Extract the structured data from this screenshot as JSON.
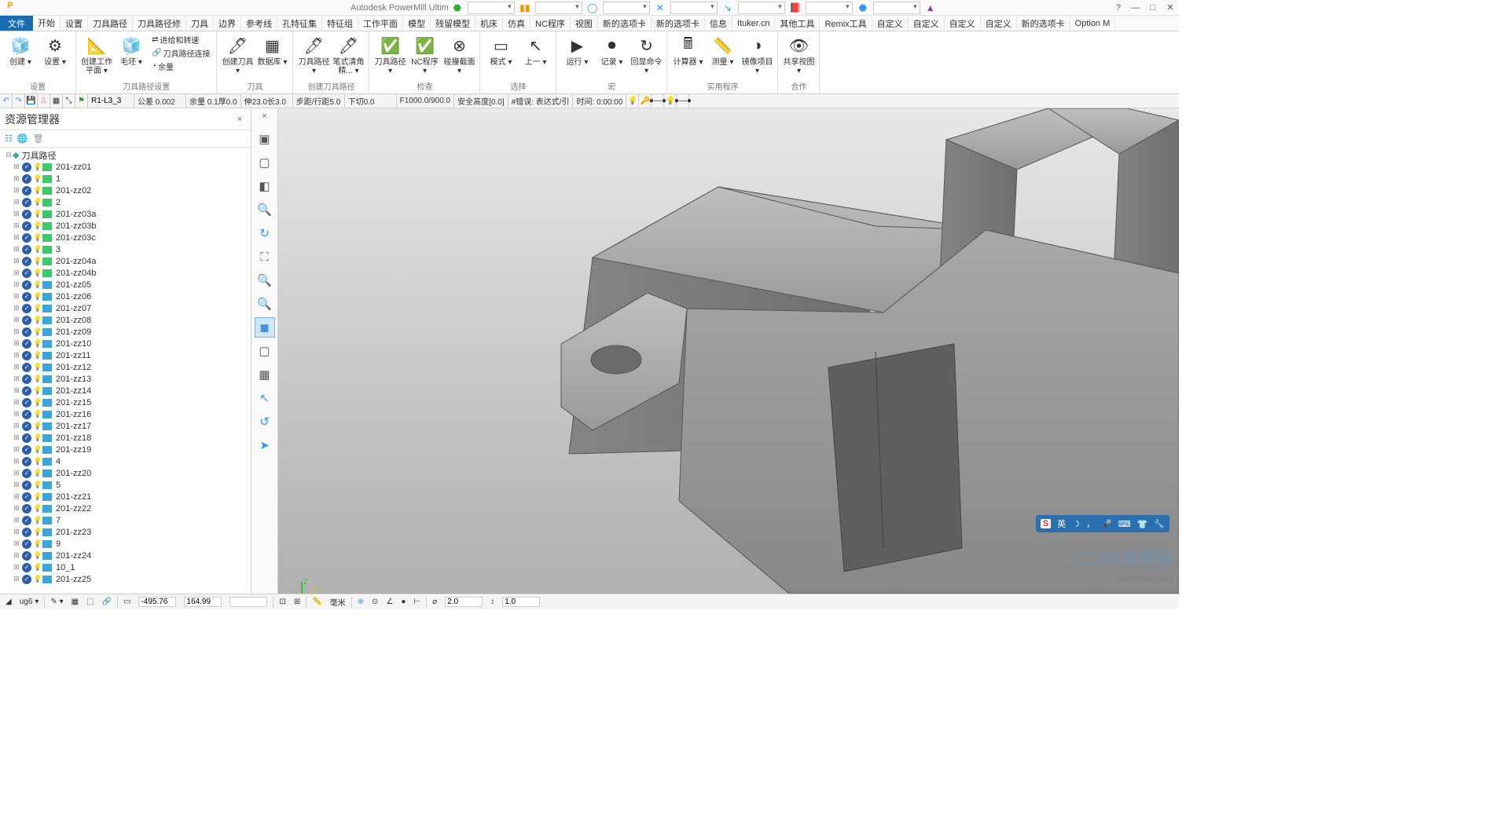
{
  "app_title": "Autodesk PowerMill Ultim",
  "window": {
    "help": "?",
    "min": "—",
    "max": "□",
    "close": "✕"
  },
  "menu": {
    "file": "文件",
    "tabs": [
      "开始",
      "设置",
      "刀具路径",
      "刀具路径修",
      "刀具",
      "边界",
      "参考线",
      "孔特征集",
      "特征组",
      "工作平面",
      "模型",
      "残留模型",
      "机床",
      "仿真",
      "NC程序",
      "视图",
      "新的选项卡",
      "新的选项卡",
      "信息",
      "Ituker.cn",
      "其他工具",
      "Remix工具",
      "自定义",
      "自定义",
      "自定义",
      "自定义",
      "新的选项卡",
      "Option M"
    ],
    "active": 0
  },
  "ribbon": {
    "groups": [
      {
        "name": "设置",
        "btns": [
          {
            "icon": "🧊",
            "lbl": "创建"
          },
          {
            "icon": "⚙",
            "lbl": "设置"
          }
        ]
      },
      {
        "name": "刀具路径设置",
        "btns": [
          {
            "icon": "📐",
            "lbl": "创建工作平面"
          },
          {
            "icon": "🧊",
            "lbl": "毛坯"
          }
        ],
        "small": [
          {
            "i": "⇄",
            "t": "进给和转速"
          },
          {
            "i": "🔗",
            "t": "刀具路径连接"
          },
          {
            "i": "◔",
            "t": "余量"
          }
        ]
      },
      {
        "name": "刀具",
        "btns": [
          {
            "icon": "🖊",
            "lbl": "创建刀具"
          },
          {
            "icon": "▦",
            "lbl": "数据库"
          }
        ]
      },
      {
        "name": "创建刀具路径",
        "btns": [
          {
            "icon": "🖊",
            "lbl": "刀具路径"
          },
          {
            "icon": "🖊",
            "lbl": "笔式清角精..."
          }
        ]
      },
      {
        "name": "检查",
        "btns": [
          {
            "icon": "✅",
            "lbl": "刀具路径"
          },
          {
            "icon": "✅",
            "lbl": "NC程序"
          },
          {
            "icon": "⊗",
            "lbl": "碰撞截面"
          }
        ]
      },
      {
        "name": "选择",
        "btns": [
          {
            "icon": "▭",
            "lbl": "模式"
          },
          {
            "icon": "↖",
            "lbl": "上一"
          }
        ]
      },
      {
        "name": "宏",
        "btns": [
          {
            "icon": "▶",
            "lbl": "运行"
          },
          {
            "icon": "⏺",
            "lbl": "记录"
          },
          {
            "icon": "↻",
            "lbl": "回显命令"
          }
        ]
      },
      {
        "name": "实用程序",
        "btns": [
          {
            "icon": "🖩",
            "lbl": "计算器"
          },
          {
            "icon": "📏",
            "lbl": "测量"
          },
          {
            "icon": "◑",
            "lbl": "镜像项目"
          }
        ]
      },
      {
        "name": "合作",
        "btns": [
          {
            "icon": "👁",
            "lbl": "共享视图"
          }
        ]
      }
    ]
  },
  "infobar": {
    "toolname": "R1-L3_3",
    "cells": [
      "公差 0.002",
      "余量 0.1厚0.0",
      "伸23.0长3.0",
      "步距/行距5.0",
      "下切0.0",
      "F1000.0/900.0",
      "安全高度[0.0]",
      "#错误: 表达式/引",
      "时间: 0:00:00"
    ]
  },
  "explorer": {
    "title": "资源管理器",
    "root": "刀具路径",
    "items": [
      {
        "t": "g",
        "n": "201-zz01"
      },
      {
        "t": "g",
        "n": "1"
      },
      {
        "t": "g",
        "n": "201-zz02"
      },
      {
        "t": "g",
        "n": "2"
      },
      {
        "t": "g",
        "n": "201-zz03a"
      },
      {
        "t": "g",
        "n": "201-zz03b"
      },
      {
        "t": "g",
        "n": "201-zz03c"
      },
      {
        "t": "g",
        "n": "3"
      },
      {
        "t": "g",
        "n": "201-zz04a"
      },
      {
        "t": "g",
        "n": "201-zz04b"
      },
      {
        "t": "b",
        "n": "201-zz05"
      },
      {
        "t": "b",
        "n": "201-zz06"
      },
      {
        "t": "b",
        "n": "201-zz07"
      },
      {
        "t": "b",
        "n": "201-zz08"
      },
      {
        "t": "b",
        "n": "201-zz09"
      },
      {
        "t": "b",
        "n": "201-zz10"
      },
      {
        "t": "b",
        "n": "201-zz11"
      },
      {
        "t": "b",
        "n": "201-zz12"
      },
      {
        "t": "b",
        "n": "201-zz13"
      },
      {
        "t": "b",
        "n": "201-zz14"
      },
      {
        "t": "b",
        "n": "201-zz15"
      },
      {
        "t": "b",
        "n": "201-zz16"
      },
      {
        "t": "b",
        "n": "201-zz17"
      },
      {
        "t": "b",
        "n": "201-zz18"
      },
      {
        "t": "b",
        "n": "201-zz19"
      },
      {
        "t": "b",
        "n": "4"
      },
      {
        "t": "b",
        "n": "201-zz20"
      },
      {
        "t": "b",
        "n": "5"
      },
      {
        "t": "b",
        "n": "201-zz21"
      },
      {
        "t": "b",
        "n": "201-zz22"
      },
      {
        "t": "b",
        "n": "7"
      },
      {
        "t": "b",
        "n": "201-zz23"
      },
      {
        "t": "b",
        "n": "9"
      },
      {
        "t": "b",
        "n": "201-zz24"
      },
      {
        "t": "b",
        "n": "10_1"
      },
      {
        "t": "b",
        "n": "201-zz25"
      }
    ]
  },
  "status": {
    "plane": "ug6",
    "x": "-495.76",
    "y": "164.99",
    "unit": "毫米",
    "dia": "2.0",
    "len": "1.0"
  },
  "watermark": "3D世界网",
  "watermark2": "www.3dsw.com",
  "float": {
    "s": "S",
    "lang": "英"
  }
}
